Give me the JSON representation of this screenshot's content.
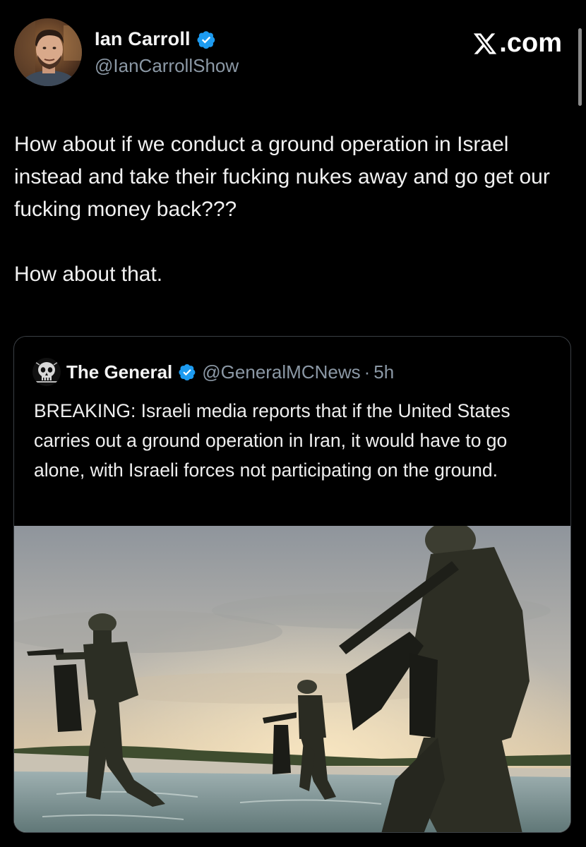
{
  "tweet": {
    "author": {
      "name": "Ian Carroll",
      "handle": "@IanCarrollShow",
      "verified": true,
      "avatar_icon": "profile-photo"
    },
    "brand": ".com",
    "brand_icon": "x-logo-icon",
    "text_paragraphs": [
      "How about if we conduct a ground operation in Israel instead and take their fucking nukes away and go get our fucking money back???",
      "How about that."
    ],
    "quoted": {
      "name": "The General",
      "handle": "@GeneralMCNews",
      "separator": "·",
      "time": "5h",
      "verified": true,
      "avatar_icon": "skull-avatar",
      "text": "BREAKING: Israeli media reports that if the United States carries out a ground operation in Iran, it would have to go alone, with Israeli forces not participating on the ground.",
      "image_icon": "soldiers-beach-landing-photo"
    }
  },
  "colors": {
    "background": "#000000",
    "text_primary": "#e7e9ea",
    "text_secondary": "#8b98a5",
    "verified_blue": "#1d9bf0",
    "card_border": "#3a3f44"
  }
}
